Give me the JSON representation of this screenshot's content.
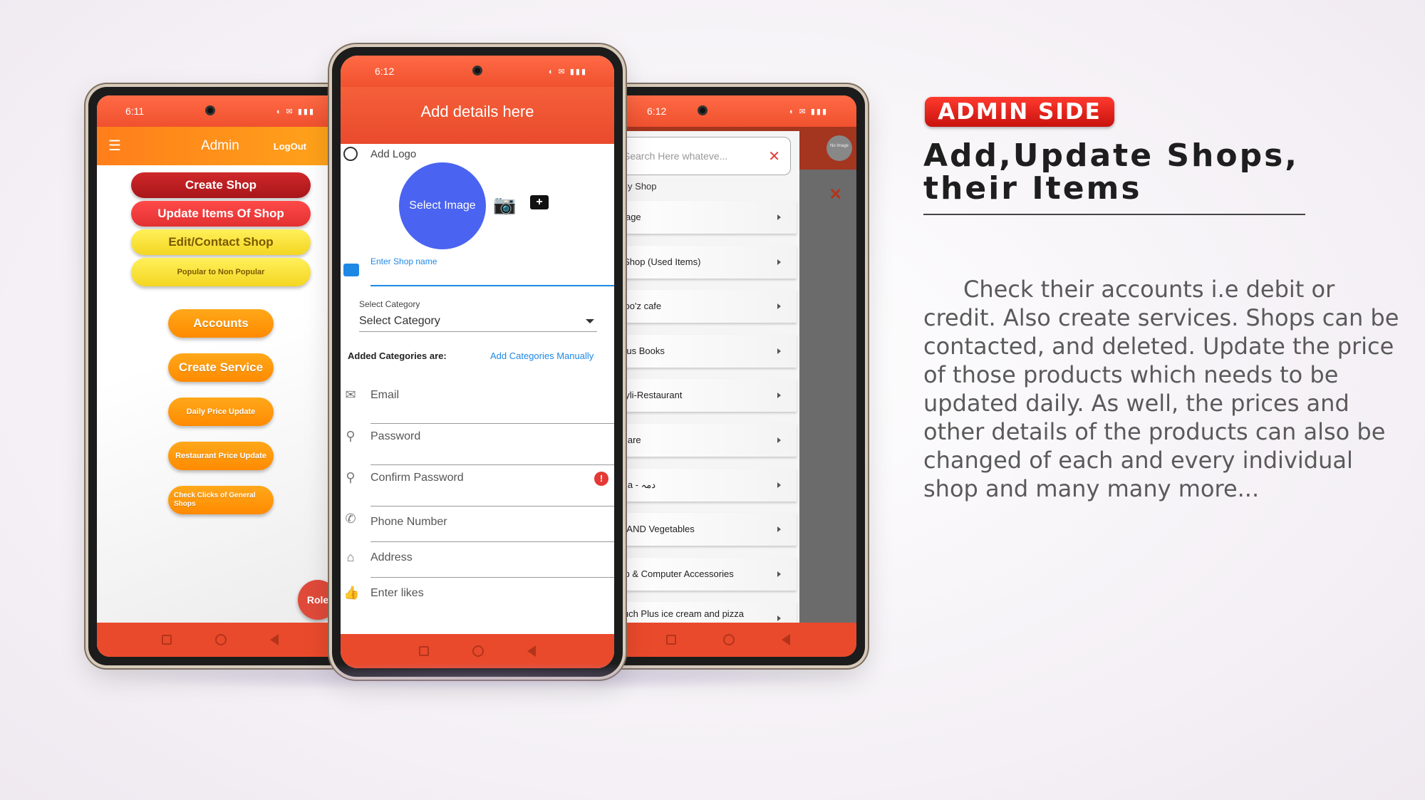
{
  "left_phone": {
    "status_time": "6:11",
    "title": "Admin",
    "logout": "LogOut",
    "buttons": {
      "create_shop": "Create Shop",
      "update_items": "Update Items Of Shop",
      "edit_contact": "Edit/Contact Shop",
      "popular": "Popular to Non Popular"
    },
    "orange_buttons": {
      "accounts": "Accounts",
      "create_service": "Create Service",
      "daily_price": "Daily Price Update",
      "restaurant_price": "Restaurant Price Update",
      "check_clicks": "Check Clicks of General Shops"
    },
    "role": "Role"
  },
  "center_phone": {
    "status_time": "6:12",
    "title": "Add details here",
    "add_logo": "Add Logo",
    "select_image": "Select Image",
    "shop_name_label": "Enter Shop name",
    "category_label": "Select Category",
    "category_value": "Select Category",
    "added_categories": "Added Categories are:",
    "add_manually": "Add Categories Manually",
    "email": "Email",
    "password": "Password",
    "confirm_password": "Confirm Password",
    "phone": "Phone Number",
    "address": "Address",
    "likes": "Enter likes"
  },
  "right_phone": {
    "status_time": "6:12",
    "search_placeholder": "Search Here whateve...",
    "choose_label": "ose any Shop",
    "no_image": "No Image",
    "shops": [
      "Beverage",
      "Olda Shop (Used Items)",
      "CooKoo'z cafe",
      "Syllabus Books",
      "Hawayli-Restaurant",
      "Hair Care",
      "Asthma - دمہ",
      "Fruits AND Vegetables",
      "Laptop & Computer Accessories",
      "ce Touch Plus ice cream and pizza house"
    ]
  },
  "promo": {
    "badge": "ADMIN SIDE",
    "heading_line1": "Add,Update Shops,",
    "heading_line2": "their Items",
    "description": "Check their accounts i.e debit or credit. Also create services. Shops can be contacted, and deleted. Update the price of those products which needs to be updated daily. As well, the prices and other details of the products can also be changed of each and every individual shop and many many more..."
  },
  "colors": {
    "primary_red": "#e94a2c",
    "orange": "#ff9a12",
    "select_blue": "#4a63f0",
    "link_blue": "#1e88e5",
    "badge_red": "#e8251e"
  }
}
